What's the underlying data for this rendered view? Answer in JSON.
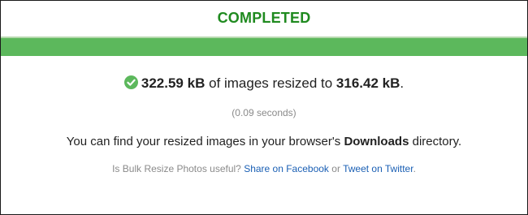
{
  "status": {
    "title": "COMPLETED",
    "progress_fraction": 1.0
  },
  "summary": {
    "original_size": "322.59 kB",
    "middle_text": " of images resized to ",
    "resized_size": "316.42 kB",
    "end_text": "."
  },
  "duration": "(0.09 seconds)",
  "info": {
    "before": "You can find your resized images in your browser's ",
    "folder": "Downloads",
    "after": " directory."
  },
  "share": {
    "question": "Is Bulk Resize Photos useful? ",
    "facebook_label": "Share on Facebook",
    "separator": " or ",
    "twitter_label": "Tweet on Twitter",
    "end": "."
  },
  "colors": {
    "title": "#1f8a1f",
    "progress": "#5cb85c",
    "link": "#1a5fb4"
  },
  "icons": {
    "summary_icon": "check-circle-icon"
  }
}
